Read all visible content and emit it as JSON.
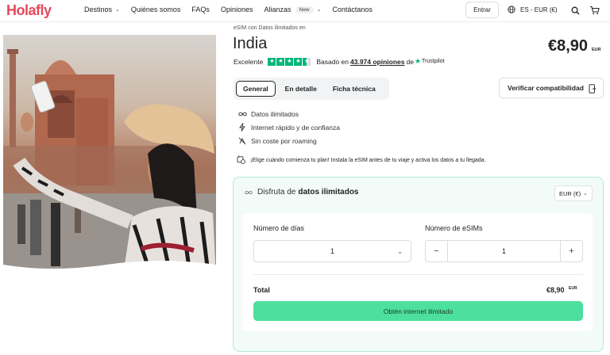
{
  "header": {
    "logo": "Holafly",
    "nav": [
      {
        "label": "Destinos"
      },
      {
        "label": "Quiénes somos"
      },
      {
        "label": "FAQs"
      },
      {
        "label": "Opiniones"
      },
      {
        "label": "Alianzas",
        "badge": "New"
      },
      {
        "label": "Contáctanos"
      }
    ],
    "login_label": "Entrar",
    "language": "ES - EUR (€)",
    "icons": [
      "globe-icon",
      "search-icon",
      "cart-icon"
    ]
  },
  "product": {
    "subtitle": "eSIM con Datos ilimitados en",
    "country": "India",
    "price": "€8,90",
    "price_currency": "EUR",
    "rating_word": "Excelente",
    "rating_stars": 4.5,
    "reviews_prefix": "Basado en",
    "reviews_count": "43.974 opiniones",
    "reviews_suffix": "de",
    "trustpilot": "Trustpilot"
  },
  "tabs": [
    {
      "label": "General",
      "active": true
    },
    {
      "label": "En detalle",
      "active": false
    },
    {
      "label": "Ficha técnica",
      "active": false
    }
  ],
  "verify_label": "Verificar compatibilidad",
  "features": [
    {
      "icon": "infinity-icon",
      "text": "Datos ilimitados"
    },
    {
      "icon": "lightning-icon",
      "text": "Internet rápido y de confianza"
    },
    {
      "icon": "no-roaming-icon",
      "text": "Sin coste por roaming"
    }
  ],
  "notice": "¡Elige cuándo comienza tu plan! Instala la eSIM antes de tu viaje y activa los datos a tu llegada.",
  "panel": {
    "prefix": "Disfruta de",
    "highlight": "datos ilimitados",
    "currency_select": "EUR (€)",
    "days_label": "Número de días",
    "days_value": "1",
    "esims_label": "Número de eSIMs",
    "esims_value": "1",
    "minus": "−",
    "plus": "+",
    "total_label": "Total",
    "total_price": "€8,90",
    "total_currency": "EUR",
    "cta": "Obtén internet ilimitado"
  },
  "colors": {
    "brand": "#e6485c",
    "trustpilot_green": "#00b67a",
    "cta_green": "#4cdf9e",
    "panel_bg": "#f2fbf8",
    "panel_border": "#b7ead8"
  }
}
